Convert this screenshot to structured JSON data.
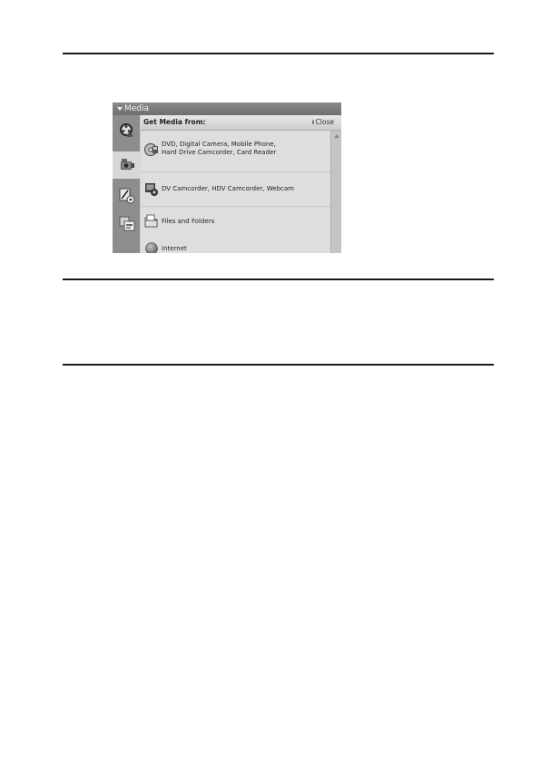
{
  "panel": {
    "title": "Media"
  },
  "content": {
    "header_label": "Get Media from:",
    "close_label": "Close",
    "items": [
      {
        "line1": "DVD, Digital Camera, Mobile Phone,",
        "line2": "Hard Drive Camcorder, Card Reader",
        "icon": "camera-dvd-icon"
      },
      {
        "line1": "DV Camcorder, HDV Camcorder, Webcam",
        "icon": "camcorder-icon"
      },
      {
        "line1": "Files and Folders",
        "icon": "folder-icon"
      },
      {
        "line1": "Internet",
        "icon": "globe-icon"
      }
    ]
  },
  "sidebar": {
    "icons": [
      "film-reel-icon",
      "camcorder-tab-icon",
      "edit-tab-icon",
      "share-tab-icon"
    ]
  }
}
